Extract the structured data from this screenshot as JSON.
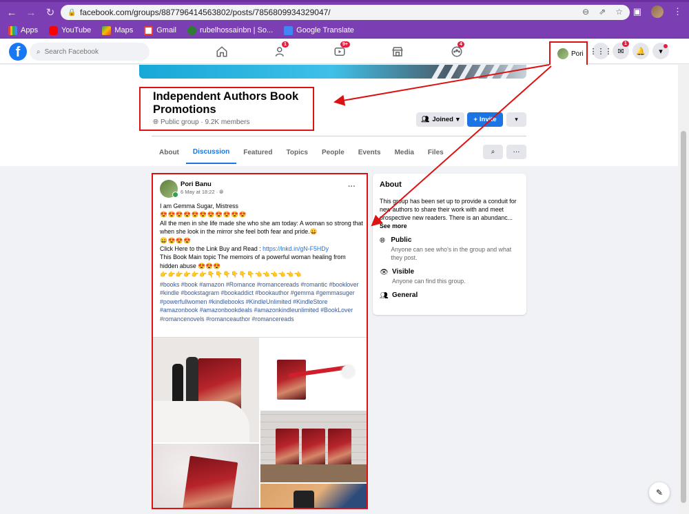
{
  "browser": {
    "url": "facebook.com/groups/887796414563802/posts/7856809934329047/",
    "bookmarks": [
      "Apps",
      "YouTube",
      "Maps",
      "Gmail",
      "rubelhossainbn | So...",
      "Google Translate"
    ]
  },
  "fb_header": {
    "search_placeholder": "Search Facebook",
    "badges": {
      "friends": "1",
      "watch": "9+",
      "groups": "4",
      "messenger": "1"
    },
    "profile_name": "Pori"
  },
  "group": {
    "title": "Independent Authors Book Promotions",
    "meta": "Public group · 9.2K members",
    "joined_label": "Joined",
    "invite_label": "Invite",
    "tabs": [
      "About",
      "Discussion",
      "Featured",
      "Topics",
      "People",
      "Events",
      "Media",
      "Files"
    ]
  },
  "post": {
    "author": "Pori Banu",
    "time": "6 May at 18:22 ·",
    "line1": "I am Gemma Sugar, Mistress",
    "emoji1": "😍😍😍😍😍😍😍😍😍😍😍",
    "line2": "All the men in she life made she who she am today: A woman so strong that when she look in the mirror she feel both fear and pride.😀",
    "emoji2": "😀😍😍😍",
    "line3_prefix": "Click Here to the Link Buy and Read : ",
    "link": "https://lnkd.in/gN-F5HDy",
    "line4": "This Book Main topic The memoirs of a powerful woman healing from hidden abuse 😍😍😍",
    "emoji3": "👉👉👉👉👉👉👇👇👇👇👇👇👈👈👈👈👈👈",
    "hashtags": "#books #book #amazon #Romance #romancereads #romantic #booklover #kindle #bookstagram #bookaddict #bookauthor #gemma #gemmasuger #powerfullwomen #kindlebooks #KindleUnlimited #KindleStore #amazonbook #amazonbookdeals #amazonkindleunlimited #BookLover #romancenovels #romanceauthor #romancereads"
  },
  "about": {
    "title": "About",
    "description_prefix": "This group has been set up to provide a conduit for new authors to share their work with and meet prospective new readers. There is an abundanc... ",
    "see_more": "See more",
    "public_title": "Public",
    "public_desc": "Anyone can see who's in the group and what they post.",
    "visible_title": "Visible",
    "visible_desc": "Anyone can find this group.",
    "general_title": "General"
  },
  "colors": {
    "accent": "#1b74e4",
    "annotation": "#dd1111",
    "chrome": "#7b3fb3"
  }
}
